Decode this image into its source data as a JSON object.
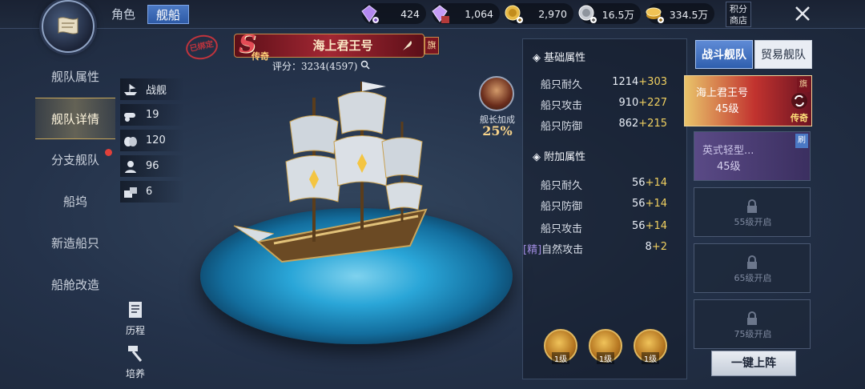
{
  "top": {
    "tabs": [
      {
        "label": "角色",
        "active": false
      },
      {
        "label": "舰船",
        "active": true
      }
    ],
    "currencies": [
      {
        "icon": "purple-gem-plus-icon",
        "value": "424"
      },
      {
        "icon": "purple-gem-bound-icon",
        "value": "1,064",
        "tag": "绑"
      },
      {
        "icon": "gold-coin-plus-icon",
        "value": "2,970"
      },
      {
        "icon": "silver-coin-plus-icon",
        "value": "16.5万"
      },
      {
        "icon": "gold-coins-plus-icon",
        "value": "334.5万"
      }
    ],
    "points_shop": "积分商店"
  },
  "nav": {
    "items": [
      {
        "label": "舰队属性",
        "active": false
      },
      {
        "label": "舰队详情",
        "active": true
      },
      {
        "label": "分支舰队",
        "active": false,
        "red_dot": true
      },
      {
        "label": "船坞",
        "active": false
      },
      {
        "label": "新造船只",
        "active": false
      },
      {
        "label": "船舱改造",
        "active": false
      }
    ]
  },
  "ship": {
    "bound_stamp": "已绑定",
    "grade": "S",
    "grade_label": "传奇",
    "name": "海上君王号",
    "flag": "旗",
    "rating": "评分：3234(4597)",
    "stats": [
      {
        "icon": "ship-type-icon",
        "value": "战舰"
      },
      {
        "icon": "cannon-icon",
        "value": "19"
      },
      {
        "icon": "cargo-icon",
        "value": "120"
      },
      {
        "icon": "sailor-icon",
        "value": "96"
      },
      {
        "icon": "supply-icon",
        "value": "6"
      }
    ],
    "captain_label": "舰长加成",
    "captain_bonus": "25%",
    "history_label": "历程",
    "train_label": "培养"
  },
  "attributes": {
    "base_title": "基础属性",
    "base": [
      {
        "name": "船只耐久",
        "value": "1214",
        "inc": "+303"
      },
      {
        "name": "船只攻击",
        "value": "910",
        "inc": "+227"
      },
      {
        "name": "船只防御",
        "value": "862",
        "inc": "+215"
      }
    ],
    "extra_title": "附加属性",
    "extra": [
      {
        "name": "船只耐久",
        "value": "56",
        "inc": "+14"
      },
      {
        "name": "船只防御",
        "value": "56",
        "inc": "+14"
      },
      {
        "name": "船只攻击",
        "value": "56",
        "inc": "+14"
      },
      {
        "prefix": "[精]",
        "name": "自然攻击",
        "value": "8",
        "inc": "+2"
      }
    ],
    "skills": [
      {
        "icon": "sword-ship-skill-icon",
        "level": "1级"
      },
      {
        "icon": "sail-ship-skill-icon",
        "level": "1级"
      },
      {
        "icon": "burst-ship-skill-icon",
        "level": "1级"
      }
    ]
  },
  "fleet": {
    "tabs": [
      {
        "label": "战斗舰队",
        "active": true
      },
      {
        "label": "贸易舰队",
        "active": false
      }
    ],
    "cards": [
      {
        "name": "海上君王号",
        "level": "45级",
        "flag": "旗",
        "grade": "传奇",
        "state": "active"
      },
      {
        "name": "英式轻型...",
        "level": "45级",
        "flag": "刷",
        "state": "normal"
      },
      {
        "lock": "55级开启",
        "state": "locked"
      },
      {
        "lock": "65级开启",
        "state": "locked"
      },
      {
        "lock": "75级开启",
        "state": "locked"
      }
    ],
    "deploy_label": "一键上阵"
  },
  "colors": {
    "accent": "#2f5fae",
    "gold": "#f0d060",
    "red": "#a22733"
  }
}
